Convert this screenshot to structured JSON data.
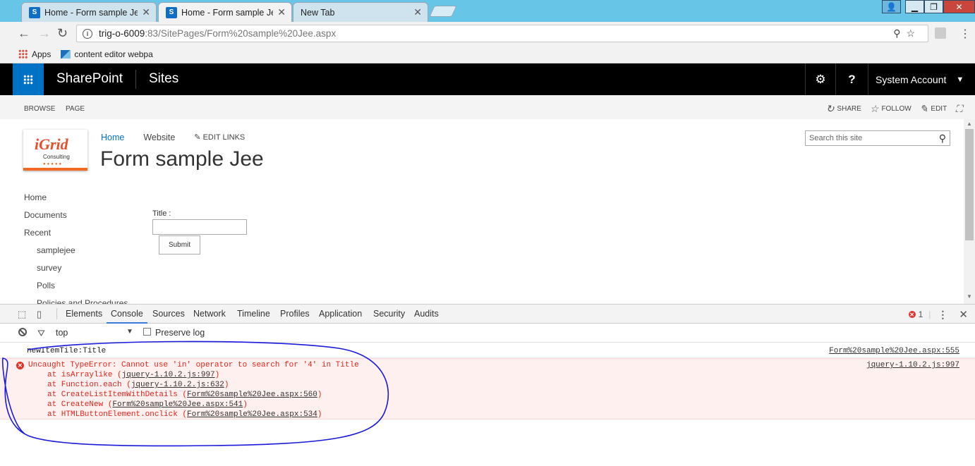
{
  "browser": {
    "tabs": [
      {
        "title": "Home - Form sample Jee",
        "active": false
      },
      {
        "title": "Home - Form sample Jee",
        "active": true
      },
      {
        "title": "New Tab",
        "active": false
      }
    ],
    "url_host": "trig-o-6009",
    "url_path": ":83/SitePages/Form%20sample%20Jee.aspx",
    "bookmarks": {
      "apps": "Apps",
      "item1": "content editor webpa"
    }
  },
  "suitebar": {
    "brand": "SharePoint",
    "sites": "Sites",
    "account": "System Account"
  },
  "ribbon": {
    "tabs": [
      "BROWSE",
      "PAGE"
    ],
    "share": "SHARE",
    "follow": "FOLLOW",
    "edit": "EDIT"
  },
  "site": {
    "logo_text": "iGrid",
    "logo_sub": "Consulting",
    "topnav": [
      "Home",
      "Website"
    ],
    "edit_links": "EDIT LINKS",
    "title": "Form sample Jee",
    "search_placeholder": "Search this site"
  },
  "quicklaunch": {
    "items": [
      "Home",
      "Documents",
      "Recent"
    ],
    "recent": [
      "samplejee",
      "survey",
      "Polls",
      "Policies and Procedures"
    ]
  },
  "form": {
    "label": "Title :",
    "submit": "Submit"
  },
  "devtools": {
    "tabs": [
      "Elements",
      "Console",
      "Sources",
      "Network",
      "Timeline",
      "Profiles",
      "Application",
      "Security",
      "Audits"
    ],
    "error_count": "1",
    "context": "top",
    "preserve_log": "Preserve log",
    "log": {
      "message": "newItemTile:Title",
      "message_src": "Form%20sample%20Jee.aspx:555",
      "error": "Uncaught TypeError: Cannot use 'in' operator to search for '4' in Title",
      "error_src": "jquery-1.10.2.js:997",
      "stack": [
        {
          "fn": "at isArraylike (",
          "src": "jquery-1.10.2.js:997"
        },
        {
          "fn": "at Function.each (",
          "src": "jquery-1.10.2.js:632"
        },
        {
          "fn": "at CreateListItemWithDetails (",
          "src": "Form%20sample%20Jee.aspx:560"
        },
        {
          "fn": "at CreateNew (",
          "src": "Form%20sample%20Jee.aspx:541"
        },
        {
          "fn": "at HTMLButtonElement.onclick (",
          "src": "Form%20sample%20Jee.aspx:534"
        }
      ]
    }
  },
  "colors": {
    "tabstrip": "#67c5e8",
    "suitebar": "#000000",
    "waffle": "#0072c6",
    "error": "#e0261c",
    "annotation": "#1a1adb"
  }
}
